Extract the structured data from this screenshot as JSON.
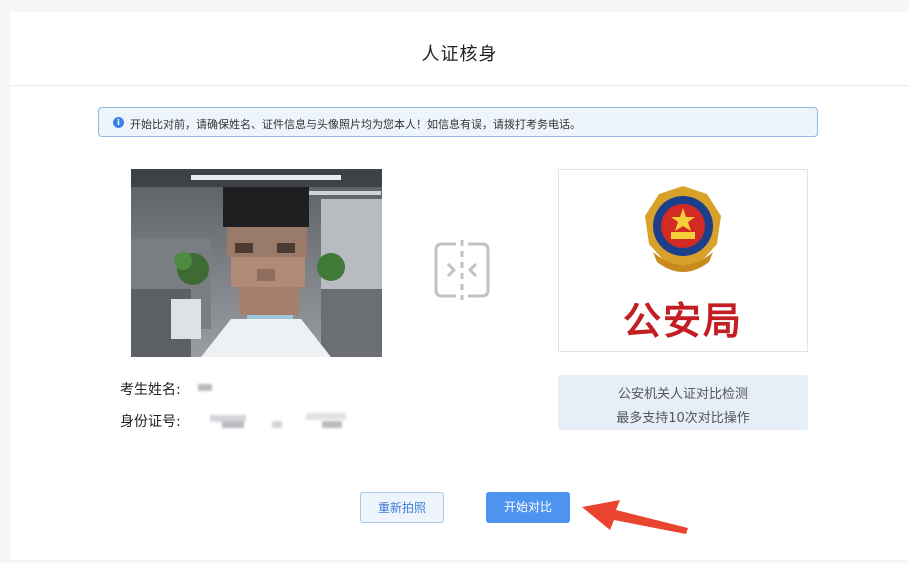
{
  "page": {
    "title": "人证核身"
  },
  "notice": {
    "icon": "info-icon",
    "text": "开始比对前，请确保姓名、证件信息与头像照片均为您本人！如信息有误，请拨打考务电话。"
  },
  "photo": {
    "description_icon": "face-photo"
  },
  "compare_icon": "compare-icon",
  "police": {
    "emblem_icon": "police-emblem-icon",
    "label": "公安局"
  },
  "candidate": {
    "name_label": "考生姓名:",
    "id_label": "身份证号:"
  },
  "info_box": {
    "line1": "公安机关人证对比检测",
    "line2": "最多支持10次对比操作"
  },
  "buttons": {
    "retake": "重新拍照",
    "start": "开始对比"
  },
  "colors": {
    "accent": "#4d94f0",
    "notice_border": "#8fb7e8",
    "police_red": "#c41e25",
    "arrow_red": "#e8442e"
  }
}
